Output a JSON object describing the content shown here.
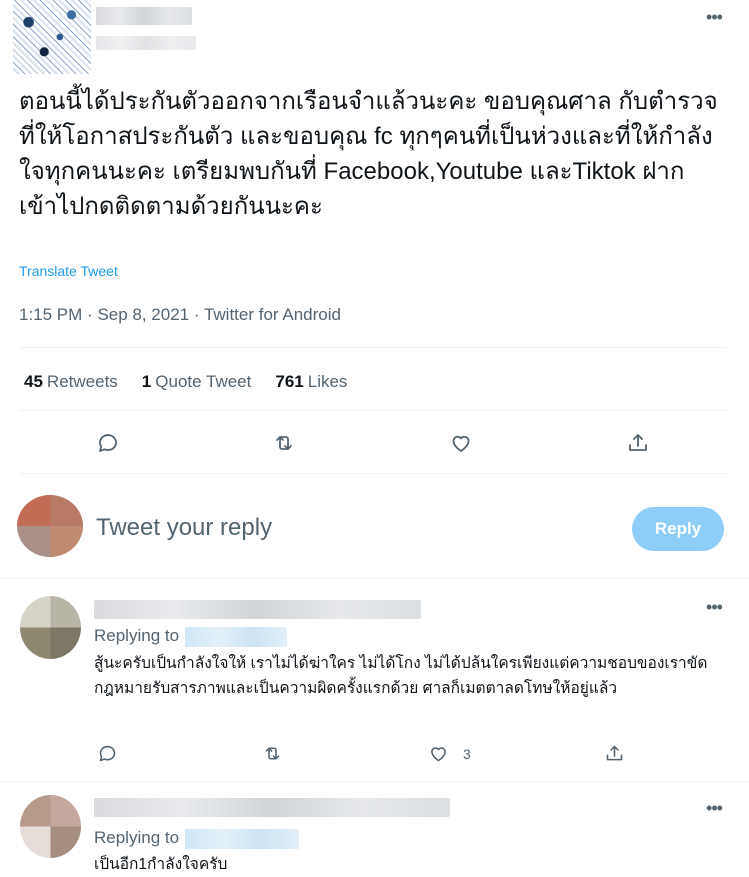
{
  "main_tweet": {
    "text": "ตอนนี้ได้ประกันตัวออกจากเรือนจำแล้วนะคะ ขอบคุณศาล กับตำรวจ ที่ให้โอกาสประกันตัว และขอบคุณ fc ทุกๆคนที่เป็นห่วงและที่ให้กำลังใจทุกคนนะคะ เตรียมพบกันที่ Facebook,Youtube และTiktok ฝากเข้าไปกดติดตามด้วยกันนะคะ",
    "translate": "Translate Tweet",
    "time": "1:15 PM",
    "date": "Sep 8, 2021",
    "source": "Twitter for Android",
    "more_icon": "more-horizontal-icon"
  },
  "stats": {
    "retweets_count": "45",
    "retweets_label": "Retweets",
    "quotes_count": "1",
    "quotes_label": "Quote Tweet",
    "likes_count": "761",
    "likes_label": "Likes"
  },
  "actions": [
    "reply-icon",
    "retweet-icon",
    "like-icon",
    "share-icon"
  ],
  "composer": {
    "placeholder": "Tweet your reply",
    "button_label": "Reply",
    "button_color": "#8ecdf7"
  },
  "replies": [
    {
      "replying_label": "Replying to",
      "text": "สู้นะครับเป็นกำลังใจให้ เราไม่ได้ฆ่าใคร ไม่ได้โกง ไม่ได้ปล้นใครเพียงแต่ความชอบของเราขัดกฎหมายรับสารภาพและเป็นความผิดครั้งแรกด้วย ศาลก็เมตตาลดโทษให้อยู่แล้ว",
      "like_count": "3"
    },
    {
      "replying_label": "Replying to",
      "text": "เป็นอีก1กำลังใจครับ"
    }
  ],
  "colors": {
    "text": "#0f1419",
    "secondary": "#536471",
    "link": "#1d9bf0",
    "divider": "#eff3f4"
  }
}
